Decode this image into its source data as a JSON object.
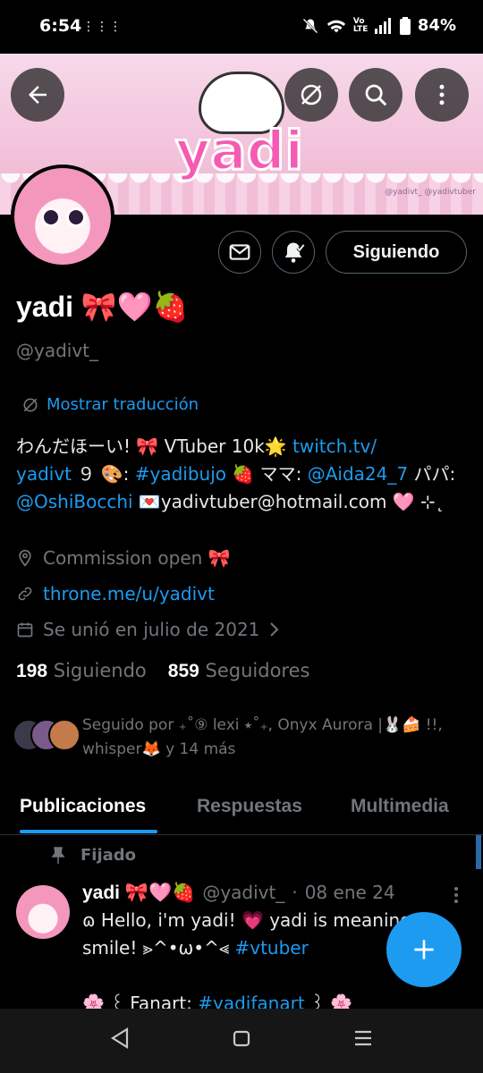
{
  "status_bar": {
    "time": "6:54",
    "dots": "⋮⋮⋮",
    "network": "Vo LTE",
    "battery": "84%"
  },
  "banner": {
    "logo_text": "yadi",
    "credit": "@yadivt_ @yadivtuber"
  },
  "profile": {
    "display_name": "yadi 🎀🩷🍓",
    "handle": "@yadivt_",
    "follow_button": "Siguiendo",
    "translate_label": "Mostrar traducción",
    "bio": {
      "t1": "わんだほーい! 🎀 VTuber 10k🌟 ",
      "link1": "twitch.tv/\nyadivt",
      "t2": " ９ 🎨: ",
      "tag1": "#yadibujo",
      "t3": " 🍓 ママ: ",
      "mention1": "@Aida24_7",
      "t4": " パパ:\n",
      "mention2": "@OshiBocchi",
      "t5": " 💌yadivtuber@hotmail.com 🩷 ⊹˛"
    },
    "location": "Commission open 🎀",
    "website": "throne.me/u/yadivt",
    "joined": "Se unió en julio de 2021",
    "following_count": "198",
    "following_label": "Siguiendo",
    "followers_count": "859",
    "followers_label": "Seguidores",
    "followed_by": "Seguido por ₊˚⑨ lexi ⭑˚₊, Onyx Aurora |🐰🍰 !!, whisper🦊 y 14 más"
  },
  "tabs": [
    "Publicaciones",
    "Respuestas",
    "Multimedia"
  ],
  "post": {
    "pinned_label": "Fijado",
    "name": "yadi 🎀🩷🍓",
    "handle": "@yadivt_",
    "sep": "·",
    "date": "08 ene 24",
    "line1": "ɷ Hello, i'm yadi! 💗 yadi is meaning",
    "line2a": "smile! ⪢^•ω•^⪡ ",
    "line2tag": "#vtuber",
    "line3a": "🌸 ꒰ Fanart: ",
    "line3tag": "#yadifanart",
    "line3b": " ꒱ 🌸"
  },
  "colors": {
    "accent": "#1d9bf0",
    "muted": "#71767b",
    "background": "#000000"
  },
  "icons": [
    "back-arrow-icon",
    "translate-icon",
    "search-icon",
    "more-vertical-icon",
    "mail-icon",
    "bell-icon",
    "location-icon",
    "link-icon",
    "calendar-icon",
    "pin-icon",
    "plus-icon"
  ]
}
